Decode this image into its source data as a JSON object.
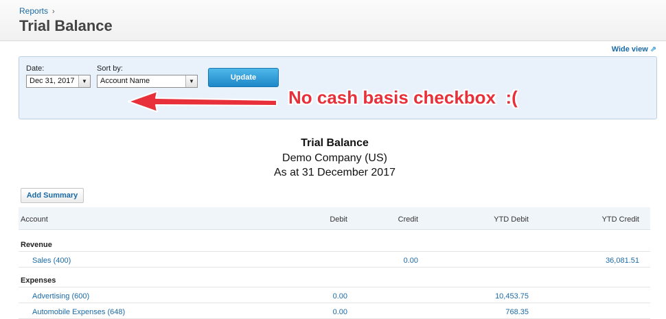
{
  "header": {
    "breadcrumb": "Reports",
    "breadcrumb_sep": "›",
    "title": "Trial Balance"
  },
  "wide_view": {
    "label": "Wide view",
    "icon": "external-arrow-icon"
  },
  "filters": {
    "date_label": "Date:",
    "date_value": "Dec 31, 2017",
    "sort_label": "Sort by:",
    "sort_value": "Account Name",
    "update_label": "Update"
  },
  "annotation": {
    "text": "No cash basis checkbox  :(",
    "color": "#e8303a"
  },
  "report": {
    "title": "Trial Balance",
    "company": "Demo Company (US)",
    "as_at": "As at 31 December 2017"
  },
  "add_summary_label": "Add Summary",
  "table": {
    "columns": [
      "Account",
      "Debit",
      "Credit",
      "YTD Debit",
      "YTD Credit"
    ],
    "groups": [
      {
        "name": "Revenue",
        "rows": [
          {
            "account": "Sales (400)",
            "debit": "",
            "credit": "0.00",
            "ytd_debit": "",
            "ytd_credit": "36,081.51"
          }
        ]
      },
      {
        "name": "Expenses",
        "rows": [
          {
            "account": "Advertising (600)",
            "debit": "0.00",
            "credit": "",
            "ytd_debit": "10,453.75",
            "ytd_credit": ""
          },
          {
            "account": "Automobile Expenses (648)",
            "debit": "0.00",
            "credit": "",
            "ytd_debit": "768.35",
            "ytd_credit": ""
          }
        ]
      }
    ]
  },
  "colors": {
    "link": "#1a6aa6",
    "button": "#1e87c8",
    "panel": "#e9f2fb"
  }
}
